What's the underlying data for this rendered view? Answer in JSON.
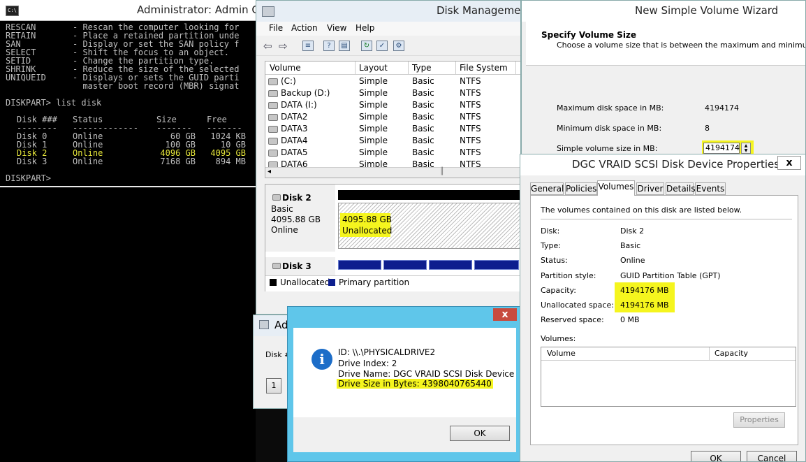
{
  "console": {
    "title": "Administrator: Admin Con",
    "icon": "cmd-icon",
    "help_lines": [
      {
        "cmd": "RESCAN",
        "desc": "- Rescan the computer looking for"
      },
      {
        "cmd": "RETAIN",
        "desc": "- Place a retained partition unde"
      },
      {
        "cmd": "SAN",
        "desc": "- Display or set the SAN policy f"
      },
      {
        "cmd": "SELECT",
        "desc": "- Shift the focus to an object."
      },
      {
        "cmd": "SETID",
        "desc": "- Change the partition type."
      },
      {
        "cmd": "SHRINK",
        "desc": "- Reduce the size of the selected"
      },
      {
        "cmd": "UNIQUEID",
        "desc": "- Displays or sets the GUID parti"
      },
      {
        "cmd": "",
        "desc": "  master boot record (MBR) signat"
      }
    ],
    "command": "DISKPART> list disk",
    "columns": [
      "Disk ###",
      "Status",
      "Size",
      "Free"
    ],
    "underlines": [
      "--------",
      "-------------",
      "-------",
      "-------"
    ],
    "disks": [
      {
        "disk": "Disk 0",
        "status": "Online",
        "size": "60 GB",
        "free": "1024 KB"
      },
      {
        "disk": "Disk 1",
        "status": "Online",
        "size": "100 GB",
        "free": "10 GB"
      },
      {
        "disk": "Disk 2",
        "status": "Online",
        "size": "4096 GB",
        "free": "4095 GB"
      },
      {
        "disk": "Disk 3",
        "status": "Online",
        "size": "7168 GB",
        "free": "894 MB"
      }
    ],
    "prompt": "DISKPART>",
    "highlight_color": "#e6e63a"
  },
  "disk_mgmt": {
    "title": "Disk Management",
    "menu": [
      "File",
      "Action",
      "View",
      "Help"
    ],
    "columns": [
      "Volume",
      "Layout",
      "Type",
      "File System"
    ],
    "volumes": [
      {
        "name": "(C:)",
        "layout": "Simple",
        "type": "Basic",
        "fs": "NTFS"
      },
      {
        "name": "Backup (D:)",
        "layout": "Simple",
        "type": "Basic",
        "fs": "NTFS"
      },
      {
        "name": "DATA (I:)",
        "layout": "Simple",
        "type": "Basic",
        "fs": "NTFS"
      },
      {
        "name": "DATA2",
        "layout": "Simple",
        "type": "Basic",
        "fs": "NTFS"
      },
      {
        "name": "DATA3",
        "layout": "Simple",
        "type": "Basic",
        "fs": "NTFS"
      },
      {
        "name": "DATA4",
        "layout": "Simple",
        "type": "Basic",
        "fs": "NTFS"
      },
      {
        "name": "DATA5",
        "layout": "Simple",
        "type": "Basic",
        "fs": "NTFS"
      },
      {
        "name": "DATA6",
        "layout": "Simple",
        "type": "Basic",
        "fs": "NTFS"
      }
    ],
    "disk2": {
      "name": "Disk 2",
      "type": "Basic",
      "size": "4095.88 GB",
      "status": "Online",
      "region_size": "4095.88 GB",
      "region_state": "Unallocated"
    },
    "disk3": {
      "name": "Disk 3"
    },
    "legend": [
      {
        "label": "Unallocated",
        "color": "#000000"
      },
      {
        "label": "Primary partition",
        "color": "#0d1e8e"
      }
    ]
  },
  "small_window": {
    "title": "Ad",
    "label": "Disk #",
    "button": "1"
  },
  "info_dialog": {
    "close": "x",
    "lines": [
      "ID: \\\\.\\PHYSICALDRIVE2",
      "Drive Index: 2",
      "Drive Name: DGC VRAID SCSI Disk Device",
      "Drive Size in Bytes: 4398040765440"
    ],
    "ok": "OK"
  },
  "wizard": {
    "title": "New Simple Volume Wizard",
    "heading": "Specify Volume Size",
    "subheading": "Choose a volume size that is between the maximum and minimum sizes.",
    "max_label": "Maximum disk space in MB:",
    "max_value": "4194174",
    "min_label": "Minimum disk space in MB:",
    "min_value": "8",
    "size_label": "Simple volume size in MB:",
    "size_value": "4194174"
  },
  "properties": {
    "title": "DGC VRAID SCSI Disk Device Properties",
    "close": "x",
    "tabs": [
      "General",
      "Policies",
      "Volumes",
      "Driver",
      "Details",
      "Events"
    ],
    "active_tab": "Volumes",
    "intro": "The volumes contained on this disk are listed below.",
    "fields": [
      {
        "label": "Disk:",
        "value": "Disk 2"
      },
      {
        "label": "Type:",
        "value": "Basic"
      },
      {
        "label": "Status:",
        "value": "Online"
      },
      {
        "label": "Partition style:",
        "value": "GUID Partition Table (GPT)"
      },
      {
        "label": "Capacity:",
        "value": "4194176 MB"
      },
      {
        "label": "Unallocated space:",
        "value": "4194176 MB"
      },
      {
        "label": "Reserved space:",
        "value": "0 MB"
      }
    ],
    "volumes_label": "Volumes:",
    "table_columns": [
      "Volume",
      "Capacity"
    ],
    "properties_button": "Properties",
    "ok": "OK",
    "cancel": "Cancel"
  }
}
